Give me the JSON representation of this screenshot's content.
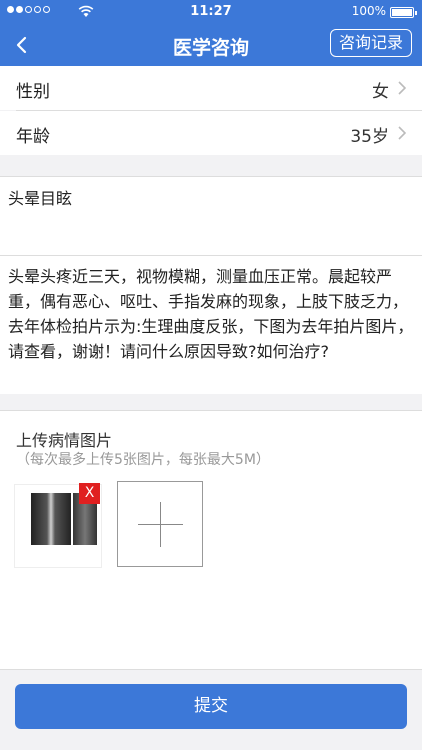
{
  "status_bar": {
    "time": "11:27",
    "battery": "100%"
  },
  "nav": {
    "title": "医学咨询",
    "record_button": "咨询记录"
  },
  "form": {
    "gender": {
      "label": "性别",
      "value": "女"
    },
    "age": {
      "label": "年龄",
      "value": "35岁"
    }
  },
  "subject": {
    "value": "头晕目眩"
  },
  "description": {
    "value": "头晕头疼近三天，视物模糊，测量血压正常。晨起较严重，偶有恶心、呕吐、手指发麻的现象，上肢下肢乏力，去年体检拍片示为:生理曲度反张，下图为去年拍片图片，请查看，谢谢！请问什么原因导致?如何治疗?"
  },
  "upload": {
    "title": "上传病情图片",
    "hint": "（每次最多上传5张图片，每张最大5M）",
    "delete_label": "X"
  },
  "submit_label": "提交"
}
